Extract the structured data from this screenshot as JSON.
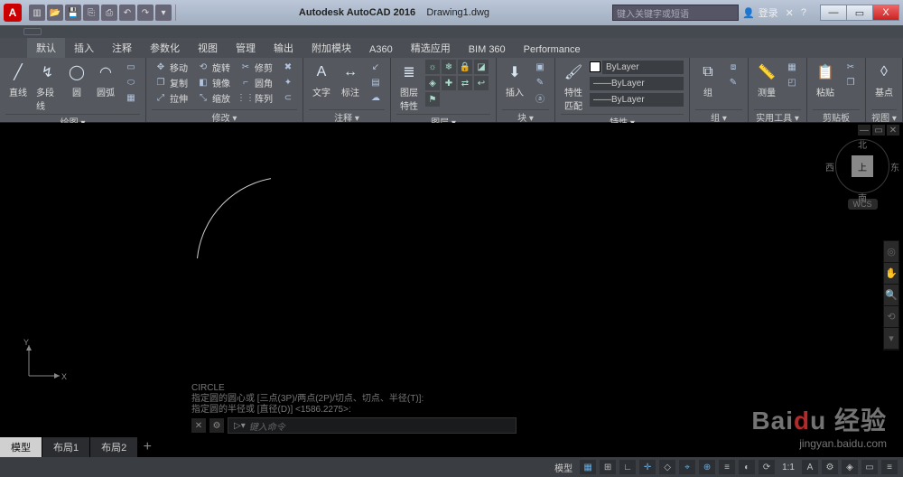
{
  "title": {
    "app": "Autodesk AutoCAD 2016",
    "doc": "Drawing1.dwg"
  },
  "search_placeholder": "键入关键字或短语",
  "account": "登录",
  "win": {
    "min": "—",
    "max": "▭",
    "close": "X"
  },
  "ribtabs": [
    "默认",
    "插入",
    "注释",
    "参数化",
    "视图",
    "管理",
    "输出",
    "附加模块",
    "A360",
    "精选应用",
    "BIM 360",
    "Performance"
  ],
  "draw": {
    "title": "绘图 ▾",
    "line": "直线",
    "pline": "多段线",
    "circle": "圆",
    "arc": "圆弧"
  },
  "modify": {
    "title": "修改 ▾",
    "move": "移动",
    "rotate": "旋转",
    "trim": "修剪",
    "copy": "复制",
    "mirror": "镜像",
    "fillet": "圆角",
    "stretch": "拉伸",
    "scale": "缩放",
    "array": "阵列"
  },
  "annot": {
    "title": "注释 ▾",
    "text": "文字",
    "dim": "标注"
  },
  "layers": {
    "title": "图层 ▾",
    "props": "图层\n特性"
  },
  "block": {
    "title": "块 ▾",
    "insert": "插入"
  },
  "match": {
    "title": "特性 ▾",
    "btn": "特性\n匹配",
    "bylayer": "ByLayer"
  },
  "group": {
    "title": "组 ▾",
    "btn": "组"
  },
  "util": {
    "title": "实用工具 ▾",
    "btn": "测量"
  },
  "clip": {
    "title": "剪贴板",
    "btn": "粘贴"
  },
  "view": {
    "title": "视图 ▾",
    "btn": "基点"
  },
  "viewcube": {
    "n": "北",
    "s": "南",
    "e": "东",
    "w": "西",
    "top": "上",
    "wcs": "WCS"
  },
  "ucs": {
    "x": "X",
    "y": "Y"
  },
  "cmdhist": [
    "CIRCLE",
    "指定圆的圆心或 [三点(3P)/两点(2P)/切点、切点、半径(T)]:",
    "指定圆的半径或 [直径(D)] <1586.2275>:"
  ],
  "cmdprompt": "键入命令",
  "cmdprefix": "▷▾",
  "ltabs": {
    "model": "模型",
    "l1": "布局1",
    "l2": "布局2",
    "plus": "+"
  },
  "status": {
    "model": "模型",
    "scale": "1:1",
    "zoom": "☼"
  },
  "watermark": {
    "brand_a": "Bai",
    "brand_b": "d",
    "brand_c": "u",
    "label": "经验",
    "url": "jingyan.baidu.com"
  }
}
